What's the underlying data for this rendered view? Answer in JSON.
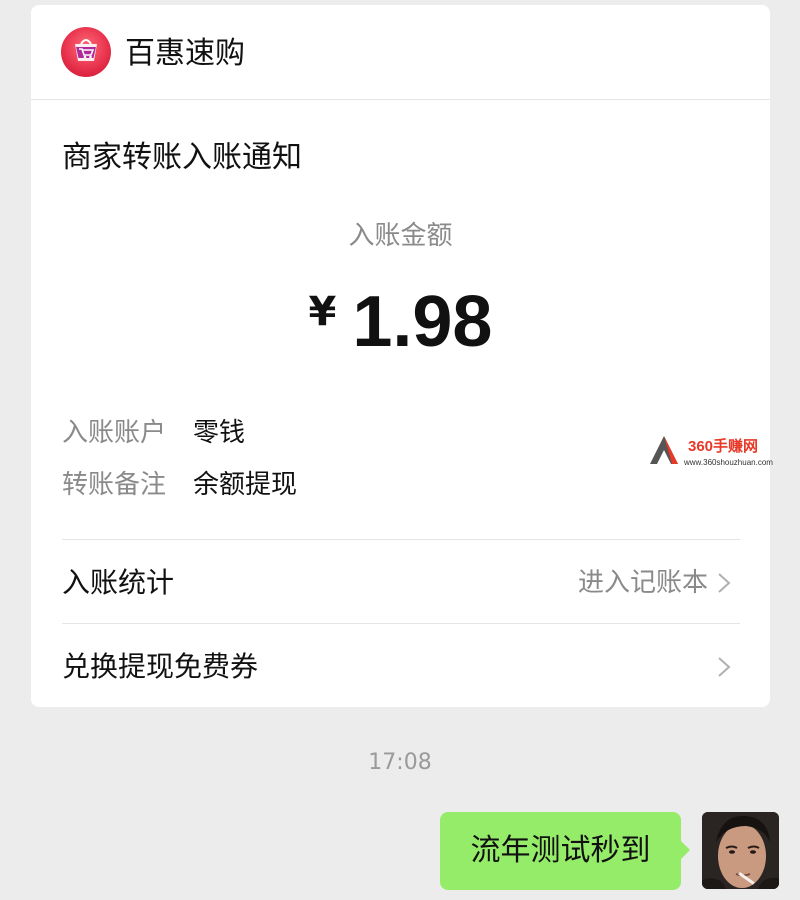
{
  "merchant": {
    "name": "百惠速购",
    "logo_icon": "shopping-cart-icon"
  },
  "notice": {
    "title": "商家转账入账通知",
    "amount_label": "入账金额",
    "currency_symbol": "¥",
    "amount": "1.98",
    "details": [
      {
        "key": "入账账户",
        "value": "零钱"
      },
      {
        "key": "转账备注",
        "value": "余额提现"
      }
    ],
    "links": [
      {
        "label": "入账统计",
        "action": "进入记账本",
        "icon": "chevron-right-icon"
      },
      {
        "label": "兑换提现免费券",
        "action": "",
        "icon": "chevron-right-icon"
      }
    ]
  },
  "watermark": {
    "brand": "360手赚网",
    "url": "www.360shouzhuan.com"
  },
  "chat": {
    "time": "17:08",
    "message": "流年测试秒到",
    "avatar_icon": "user-avatar"
  },
  "colors": {
    "bubble": "#95ec69",
    "background": "#ececec",
    "card": "#ffffff",
    "muted_text": "#8a8a8a"
  }
}
